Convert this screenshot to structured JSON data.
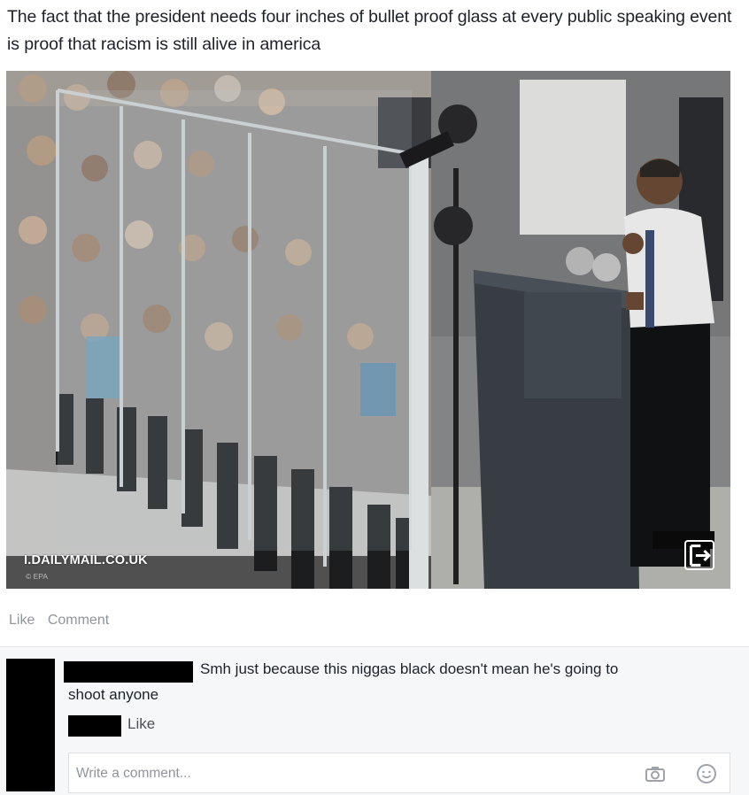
{
  "post": {
    "text": "The fact that the president needs four inches of bullet proof glass at every public speaking event is proof that racism is still alive in america"
  },
  "photo": {
    "source": "I.DAILYMAIL.CO.UK",
    "credit": "© EPA"
  },
  "actions": {
    "like_label": "Like",
    "comment_label": "Comment"
  },
  "comment": {
    "text_line1": "Smh just because this niggas black doesn't mean he's going to",
    "text_line2": "shoot anyone",
    "like_label": "Like"
  },
  "composer": {
    "placeholder": "Write a comment..."
  },
  "icons": {
    "expand": "expand-icon",
    "camera": "camera-icon",
    "emoji": "emoji-icon"
  }
}
